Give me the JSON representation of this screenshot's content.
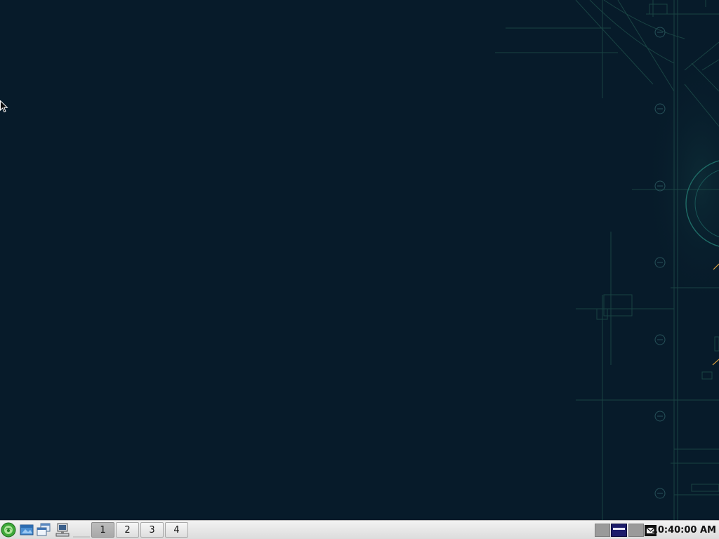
{
  "desktop": {
    "background_color": "#071b2a",
    "accent_line_color": "#2a5c57"
  },
  "taskbar": {
    "launchers": [
      {
        "name": "menu-icon"
      },
      {
        "name": "file-manager-icon"
      },
      {
        "name": "window-switcher-icon"
      },
      {
        "name": "computer-icon"
      }
    ],
    "workspaces": [
      {
        "label": "1",
        "active": true
      },
      {
        "label": "2",
        "active": false
      },
      {
        "label": "3",
        "active": false
      },
      {
        "label": "4",
        "active": false
      }
    ],
    "tray": [
      {
        "name": "pager-preview-icon"
      },
      {
        "name": "window-preview-icon"
      },
      {
        "name": "pager-preview-icon-2"
      },
      {
        "name": "mail-icon"
      }
    ],
    "clock": "10:40:00 AM"
  }
}
